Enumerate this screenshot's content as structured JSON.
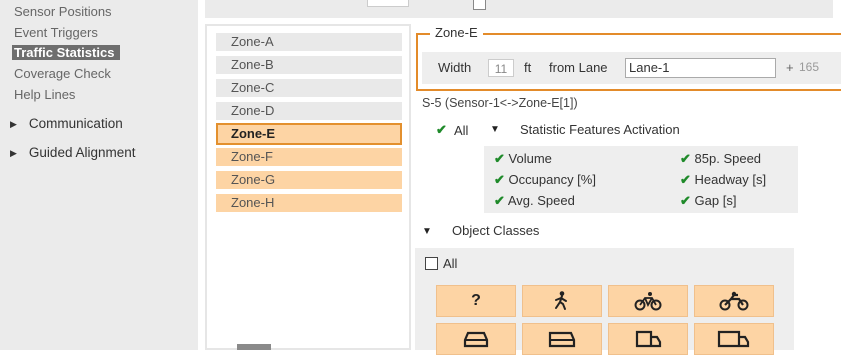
{
  "sidebar": {
    "items": [
      {
        "label": "Sensor Positions"
      },
      {
        "label": "Event Triggers"
      },
      {
        "label": "Traffic Statistics"
      },
      {
        "label": "Coverage Check"
      },
      {
        "label": "Help Lines"
      }
    ],
    "groups": [
      {
        "label": "Communication",
        "icon": "triangle-right-icon"
      },
      {
        "label": "Guided Alignment",
        "icon": "triangle-right-icon"
      }
    ]
  },
  "zones": [
    {
      "label": "Zone-A"
    },
    {
      "label": "Zone-B"
    },
    {
      "label": "Zone-C"
    },
    {
      "label": "Zone-D"
    },
    {
      "label": "Zone-E"
    },
    {
      "label": "Zone-F"
    },
    {
      "label": "Zone-G"
    },
    {
      "label": "Zone-H"
    }
  ],
  "zone_panel": {
    "title": "Zone-E",
    "width_label": "Width",
    "width_value": "11",
    "unit_label": "ft",
    "from_lane_label": "from Lane",
    "lane_value": "Lane-1",
    "plus_label": "+",
    "offset_value": "165"
  },
  "sensor_label": "S-5 (Sensor-1<->Zone-E[1])",
  "statistics": {
    "all_label": "All",
    "section_label": "Statistic Features Activation",
    "features": [
      {
        "label": "Volume"
      },
      {
        "label": "85p. Speed"
      },
      {
        "label": "Occupancy [%]"
      },
      {
        "label": "Headway [s]"
      },
      {
        "label": "Avg. Speed"
      },
      {
        "label": "Gap [s]"
      }
    ]
  },
  "object_classes": {
    "section_label": "Object Classes",
    "all_label": "All",
    "classes": [
      {
        "icon": "unknown-class-icon",
        "label": "?"
      },
      {
        "icon": "pedestrian-icon"
      },
      {
        "icon": "bicycle-icon"
      },
      {
        "icon": "motorcycle-icon"
      },
      {
        "icon": "car-icon"
      },
      {
        "icon": "van-icon"
      },
      {
        "icon": "truck-icon"
      },
      {
        "icon": "long-truck-icon"
      }
    ]
  },
  "colors": {
    "accent": "#e38b2a",
    "highlight": "#fdd4a4",
    "check": "#1f8a2a",
    "sidebar_active": "#6e6e6e"
  }
}
